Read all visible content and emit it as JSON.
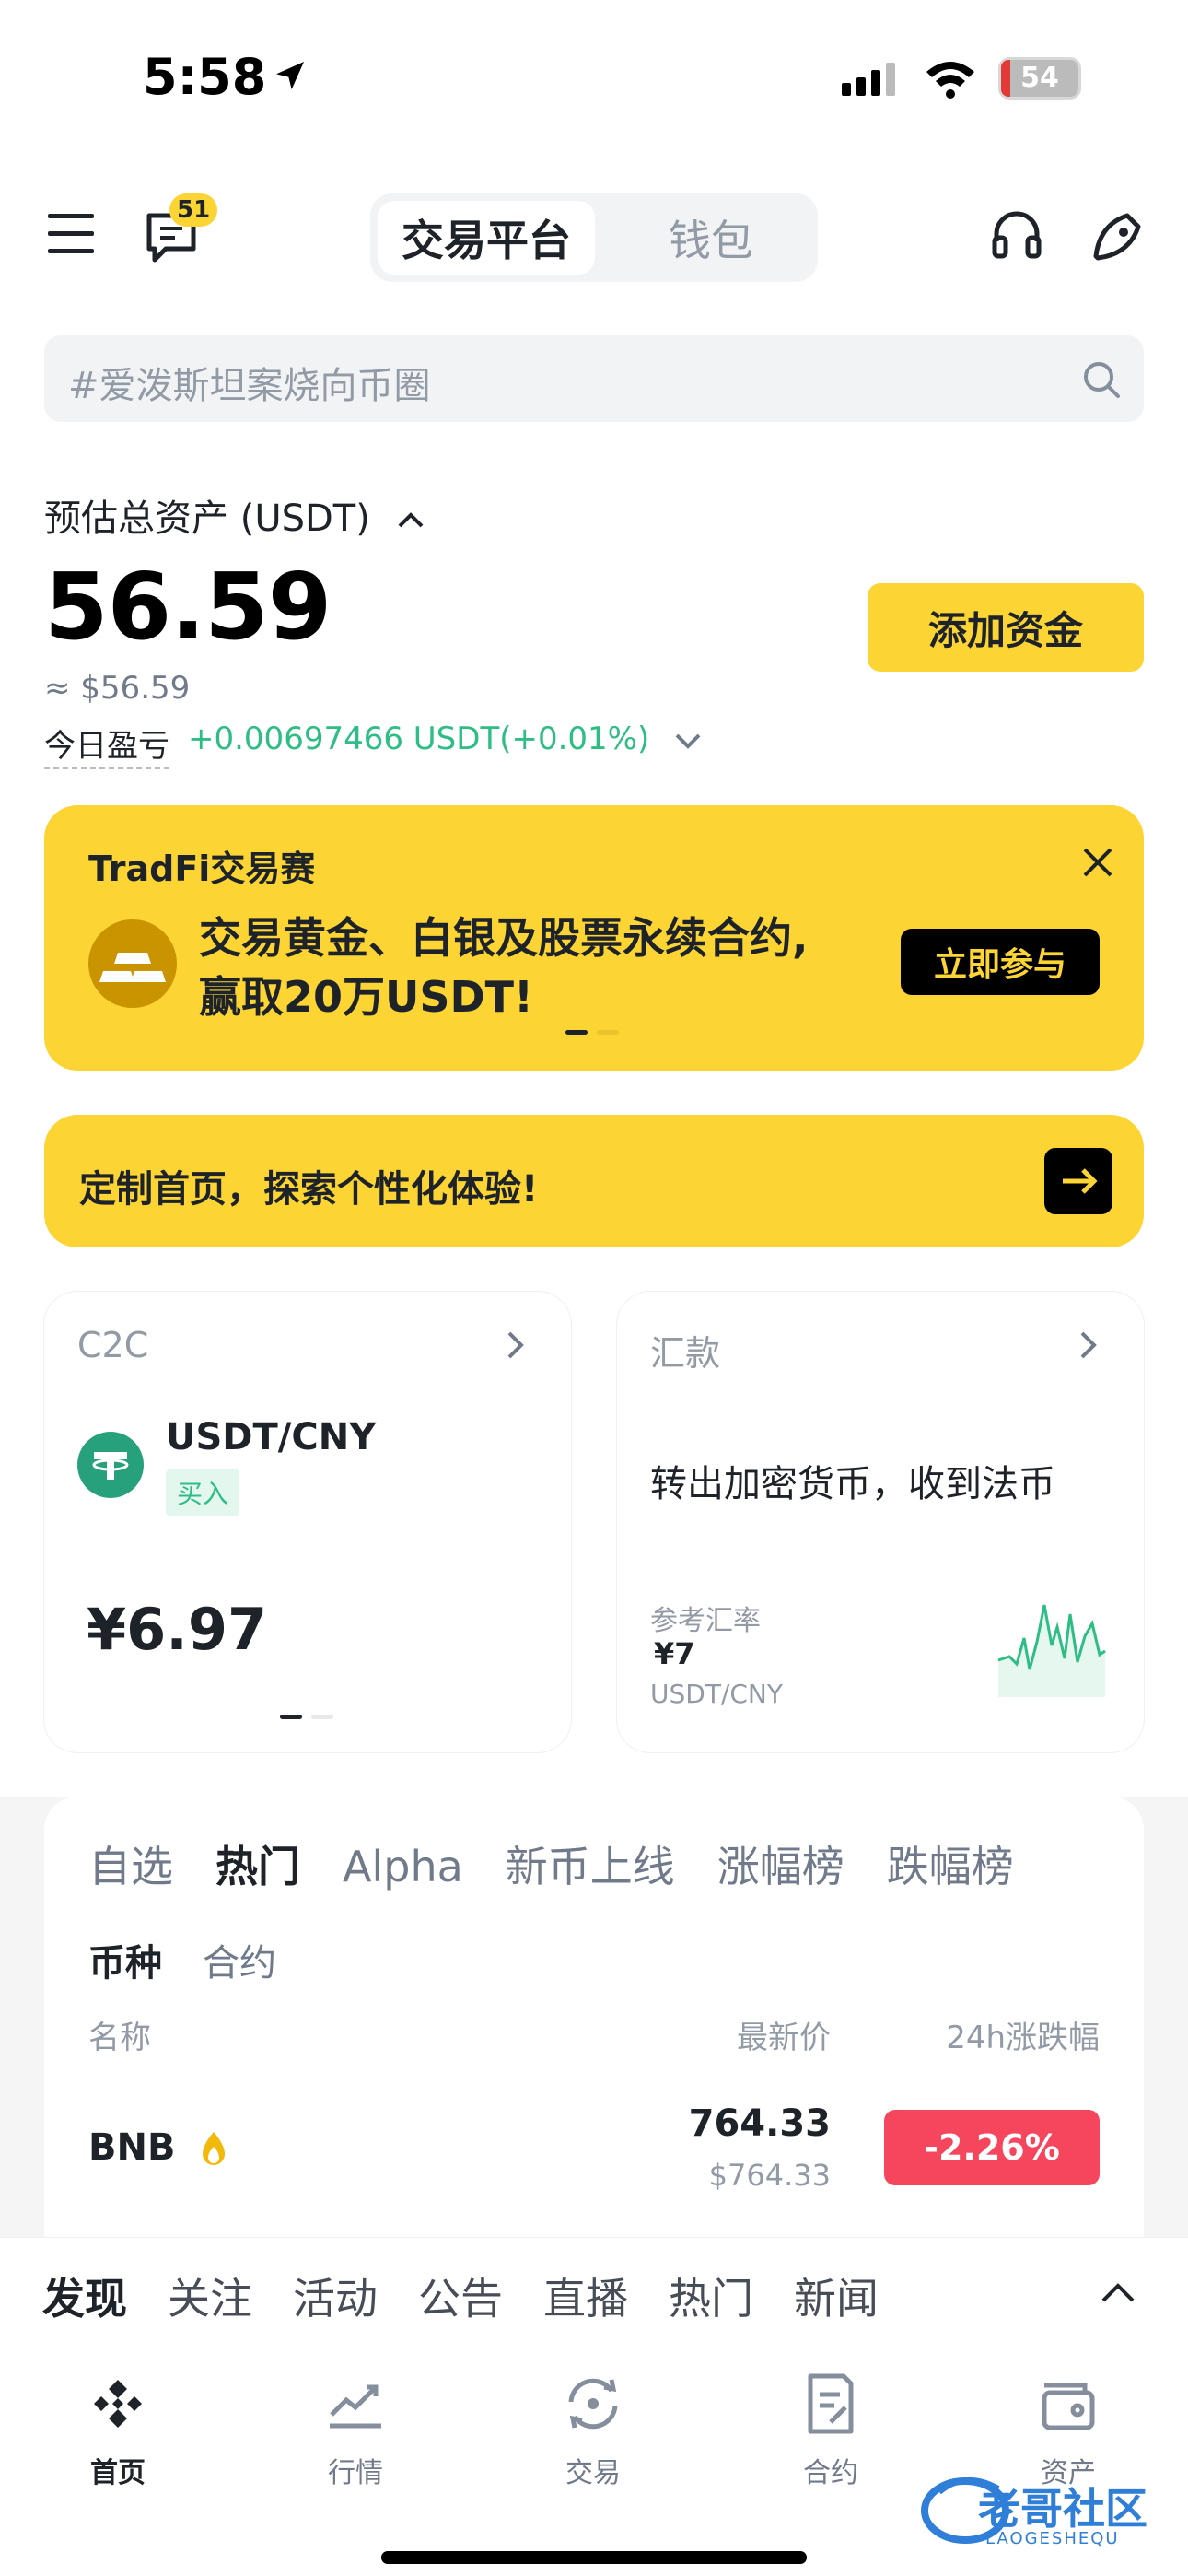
{
  "status_bar": {
    "time": "5:58",
    "battery": "54"
  },
  "header": {
    "tabs": [
      "交易平台",
      "钱包"
    ],
    "message_count": "51"
  },
  "search": {
    "placeholder": "#爱泼斯坦案烧向币圈"
  },
  "assets": {
    "label": "预估总资产 (USDT)",
    "total": "56.59",
    "approx": "≈ $56.59",
    "pnl_label": "今日盈亏",
    "pnl_value": "+0.00697466 USDT(+0.01%)",
    "add_button": "添加资金"
  },
  "promo": {
    "title": "TradFi交易赛",
    "line1": "交易黄金、白银及股票永续合约,",
    "line2": "赢取20万USDT!",
    "button": "立即参与"
  },
  "customize": {
    "text": "定制首页，探索个性化体验!"
  },
  "c2c": {
    "title": "C2C",
    "pair": "USDT/CNY",
    "tag": "买入",
    "price": "¥6.97"
  },
  "remit": {
    "title": "汇款",
    "desc": "转出加密货币，收到法币",
    "rate_label": "参考汇率",
    "rate": "¥7",
    "rate_pair": "USDT/CNY"
  },
  "markets": {
    "tabs": [
      "自选",
      "热门",
      "Alpha",
      "新币上线",
      "涨幅榜",
      "跌幅榜"
    ],
    "subtabs": [
      "币种",
      "合约"
    ],
    "col_name": "名称",
    "col_price": "最新价",
    "col_change": "24h涨跌幅",
    "rows": [
      {
        "symbol": "BNB",
        "price": "764.33",
        "price_usd": "$764.33",
        "change": "-2.26%"
      }
    ]
  },
  "discover": {
    "tabs": [
      "发现",
      "关注",
      "活动",
      "公告",
      "直播",
      "热门",
      "新闻"
    ]
  },
  "nav": {
    "items": [
      "首页",
      "行情",
      "交易",
      "合约",
      "资产"
    ]
  },
  "watermark": {
    "text": "老哥社区",
    "subtext": "LAOGESHEQU"
  },
  "colors": {
    "accent": "#fcd535",
    "up": "#2ebd85",
    "down": "#f6465d"
  }
}
